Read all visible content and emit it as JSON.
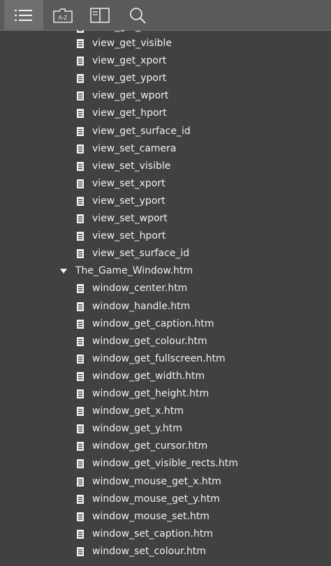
{
  "toolbar": {
    "buttons": [
      {
        "name": "contents-icon",
        "active": true
      },
      {
        "name": "index-az-icon",
        "active": false
      },
      {
        "name": "bookmarks-book-icon",
        "active": false
      },
      {
        "name": "search-icon",
        "active": false
      }
    ],
    "index_label": "A-Z"
  },
  "tree": {
    "partial_item": "view_get_id",
    "items": [
      "view_get_visible",
      "view_get_xport",
      "view_get_yport",
      "view_get_wport",
      "view_get_hport",
      "view_get_surface_id",
      "view_set_camera",
      "view_set_visible",
      "view_set_xport",
      "view_set_yport",
      "view_set_wport",
      "view_set_hport",
      "view_set_surface_id"
    ],
    "folder": {
      "label": "The_Game_Window.htm",
      "expanded": true,
      "children": [
        "window_center.htm",
        "window_handle.htm",
        "window_get_caption.htm",
        "window_get_colour.htm",
        "window_get_fullscreen.htm",
        "window_get_width.htm",
        "window_get_height.htm",
        "window_get_x.htm",
        "window_get_y.htm",
        "window_get_cursor.htm",
        "window_get_visible_rects.htm",
        "window_mouse_get_x.htm",
        "window_mouse_get_y.htm",
        "window_mouse_set.htm",
        "window_set_caption.htm",
        "window_set_colour.htm"
      ]
    }
  }
}
